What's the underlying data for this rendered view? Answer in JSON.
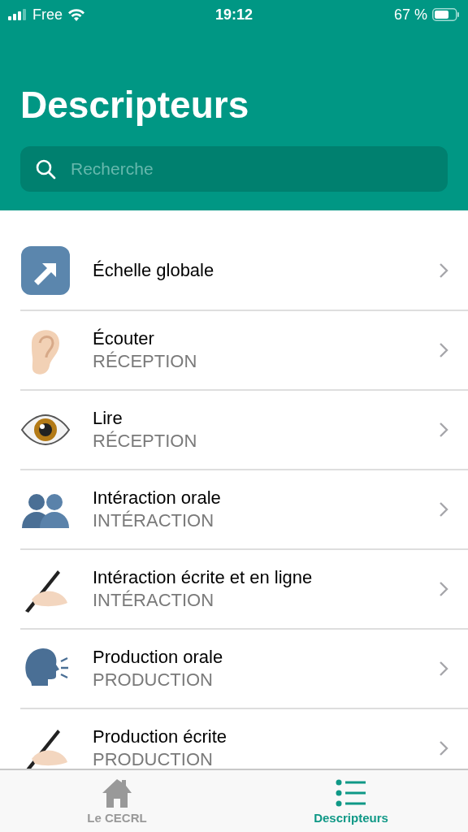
{
  "status_bar": {
    "carrier": "Free",
    "time": "19:12",
    "battery": "67 %"
  },
  "header": {
    "title": "Descripteurs",
    "search": {
      "placeholder": "Recherche"
    }
  },
  "items": [
    {
      "kind": "arrow",
      "title": "Échelle globale"
    },
    {
      "kind": "ear",
      "title": "Écouter",
      "subtitle": "RÉCEPTION"
    },
    {
      "kind": "eye",
      "title": "Lire",
      "subtitle": "RÉCEPTION"
    },
    {
      "kind": "people",
      "title": "Intéraction orale",
      "subtitle": "INTÉRACTION"
    },
    {
      "kind": "writing",
      "title": "Intéraction écrite et en ligne",
      "subtitle": "INTÉRACTION"
    },
    {
      "kind": "speaking",
      "title": "Production orale",
      "subtitle": "PRODUCTION"
    },
    {
      "kind": "writing",
      "title": "Production écrite",
      "subtitle": "PRODUCTION"
    }
  ],
  "tab_bar": [
    {
      "kind": "home",
      "label": "Le CECRL",
      "selected": false
    },
    {
      "kind": "list",
      "label": "Descripteurs",
      "selected": true
    }
  ]
}
